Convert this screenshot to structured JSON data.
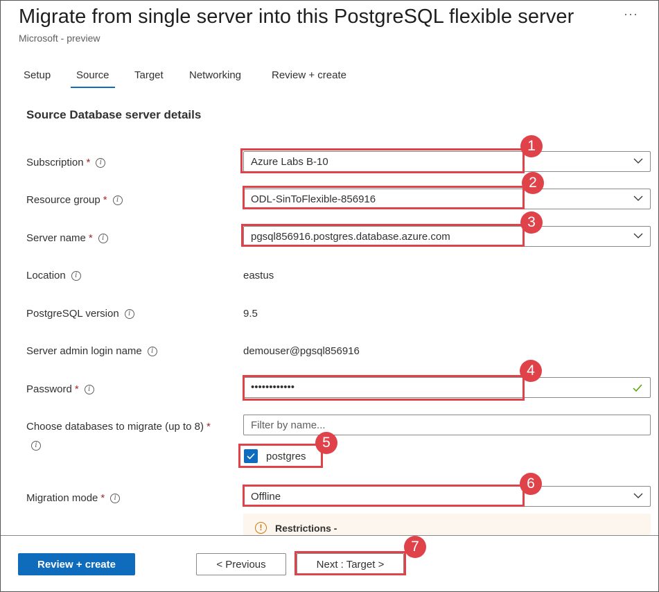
{
  "header": {
    "title": "Migrate from single server into this PostgreSQL flexible server",
    "subtitle": "Microsoft - preview",
    "more_label": "···"
  },
  "tabs": [
    {
      "label": "Setup",
      "active": false
    },
    {
      "label": "Source",
      "active": true
    },
    {
      "label": "Target",
      "active": false
    },
    {
      "label": "Networking",
      "active": false
    },
    {
      "label": "Review + create",
      "active": false
    }
  ],
  "section": {
    "title": "Source Database server details"
  },
  "form": {
    "required_mark": "*",
    "info_glyph": "i",
    "subscription": {
      "label": "Subscription",
      "value": "Azure Labs B-10"
    },
    "resource_group": {
      "label": "Resource group",
      "value": "ODL-SinToFlexible-856916"
    },
    "server_name": {
      "label": "Server name",
      "value": "pgsql856916.postgres.database.azure.com"
    },
    "location": {
      "label": "Location",
      "value": "eastus"
    },
    "pg_version": {
      "label": "PostgreSQL version",
      "value": "9.5"
    },
    "admin_login": {
      "label": "Server admin login name",
      "value": "demouser@pgsql856916"
    },
    "password": {
      "label": "Password",
      "value": "••••••••••••"
    },
    "databases": {
      "label": "Choose databases to migrate (up to 8)",
      "filter_placeholder": "Filter by name...",
      "items": [
        {
          "label": "postgres",
          "checked": true
        }
      ]
    },
    "migration_mode": {
      "label": "Migration mode",
      "value": "Offline"
    },
    "restrictions": {
      "text": "Restrictions -",
      "icon": "warning-icon"
    }
  },
  "footer": {
    "review_create": "Review + create",
    "previous": "< Previous",
    "next": "Next : Target >"
  },
  "annotations": {
    "color": "#e0424a",
    "badges": [
      "1",
      "2",
      "3",
      "4",
      "5",
      "6",
      "7"
    ]
  },
  "colors": {
    "accent": "#0f6cbd",
    "required": "#a4262c",
    "success": "#57a300",
    "warning": "#c87a12"
  }
}
